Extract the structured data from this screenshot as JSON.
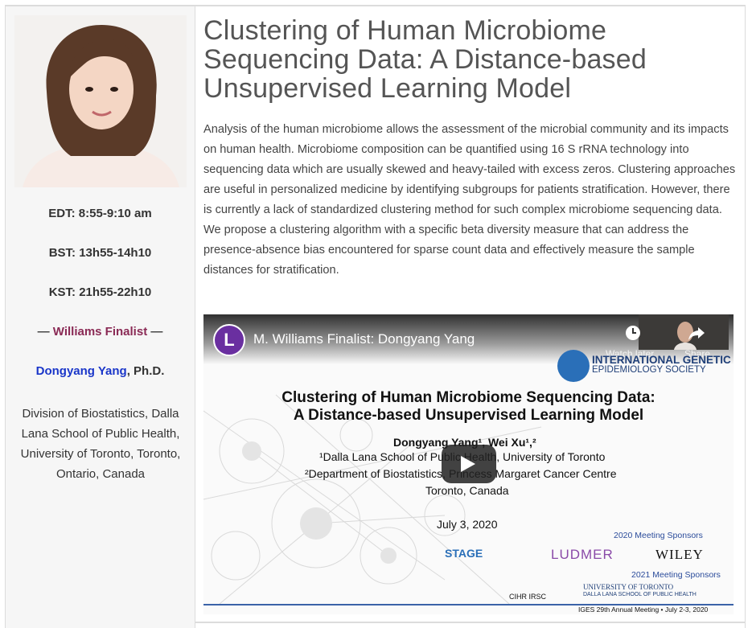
{
  "schedule": {
    "edt": "EDT: 8:55-9:10 am",
    "bst": "BST: 13h55-14h10",
    "kst": "KST: 21h55-22h10"
  },
  "finalist": {
    "dash_left": "— ",
    "label": "Williams Finalist",
    "dash_right": " —"
  },
  "speaker": {
    "name": "Dongyang Yang",
    "suffix": ", Ph.D."
  },
  "affiliation": "Division of Biostatistics, Dalla Lana School of Public Health, University of Toronto, Toronto, Ontario, Canada",
  "talk": {
    "title": "Clustering of Human Microbiome Sequencing Data: A Distance-based Unsupervised Learning Model",
    "abstract": "Analysis of the human microbiome allows the assessment of the microbial community and its impacts on human health. Microbiome composition can be quantified using 16 S rRNA technology into sequencing data which are usually skewed and heavy-tailed with excess zeros. Clustering approaches are useful in personalized medicine by identifying subgroups for patients stratification. However, there is currently a lack of standardized clustering method for such complex microbiome sequencing data. We propose a clustering algorithm with a specific beta diversity measure that can address the presence-absence bias encountered for sparse count data and effectively measure the sample distances for stratification."
  },
  "video": {
    "channel_logo_letter": "L",
    "title": "M. Williams Finalist: Dongyang Yang",
    "watch_later": "Watch later",
    "share": "Share",
    "icons": [
      "clock-icon",
      "share-icon",
      "play-icon"
    ],
    "slide": {
      "society_line1": "INTERNATIONAL GENETIC",
      "society_line2": "EPIDEMIOLOGY SOCIETY",
      "title_line1": "Clustering of Human Microbiome Sequencing Data:",
      "title_line2": "A Distance-based Unsupervised Learning Model",
      "authors": "Dongyang Yang¹, Wei Xu¹,²",
      "affil1": "¹Dalla Lana School of Public Health, University of Toronto",
      "affil2": "²Department of Biostatistics, Princess Margaret Cancer Centre",
      "city": "Toronto, Canada",
      "date": "July 3, 2020",
      "sponsors_2020": "2020 Meeting Sponsors",
      "sponsors_2021": "2021 Meeting Sponsors",
      "sponsor_stage": "STAGE",
      "sponsor_ludmer": "LUDMER",
      "sponsor_wiley": "WILEY",
      "sponsor_cihr": "CIHR IRSC",
      "sponsor_uoft1": "UNIVERSITY OF TORONTO",
      "sponsor_uoft2": "DALLA LANA SCHOOL OF PUBLIC HEALTH",
      "footer": "IGES 29th Annual Meeting • July 2-3, 2020"
    }
  },
  "colors": {
    "finalist": "#8a2a55",
    "speaker_link": "#1a36c9",
    "channel_logo": "#6a2fa0",
    "sponsor_text": "#2b4c9b"
  }
}
